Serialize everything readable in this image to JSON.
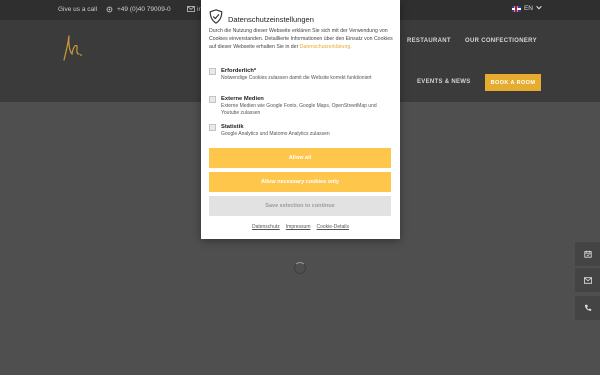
{
  "topbar": {
    "call_label": "Give us a call",
    "phone": "+49 (0)40 79009-0",
    "email_partial": "ir",
    "language": "EN"
  },
  "nav": {
    "restaurant": "RESTAURANT",
    "confectionery": "OUR CONFECTIONERY",
    "events": "EVENTS & NEWS",
    "book": "BOOK A ROOM"
  },
  "cookie_dialog": {
    "title": "Datenschutzeinstellungen",
    "intro": "Durch die Nutzung dieser Webseite erklären Sie sich mit der Verwendung von Cookies einverstanden. Detaillierte Informationen über den Einsatz von Cookies auf dieser Webseite erhalten Sie in der",
    "intro_link": "Datenschutzerklärung.",
    "options": [
      {
        "title": "Erforderlich*",
        "desc": "Notwendige Cookies zulassen damit die Website korrekt funktioniert"
      },
      {
        "title": "Externe Medien",
        "desc": "Externe Medien wie Google Fonts, Google Maps, OpenStreetMap und Youtube zulassen"
      },
      {
        "title": "Statistik",
        "desc": "Google Analytics und Matomo Analytics zulassen"
      }
    ],
    "allow_all": "Allow all",
    "allow_necessary": "Allow necessary cookies only",
    "save_selection": "Save selection to continue",
    "links": [
      "Datenschutz",
      "Impressum",
      "Cookie-Details"
    ]
  },
  "colors": {
    "accent": "#fec64b",
    "brand_gold": "#e6ac2f",
    "header_bg": "#3b3b3b",
    "backdrop": "#4f4f4f"
  }
}
